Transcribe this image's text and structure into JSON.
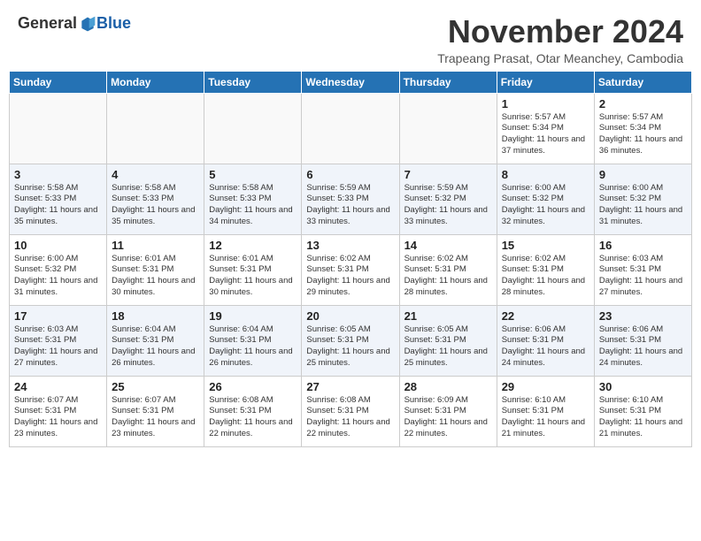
{
  "header": {
    "logo_general": "General",
    "logo_blue": "Blue",
    "month_title": "November 2024",
    "subtitle": "Trapeang Prasat, Otar Meanchey, Cambodia"
  },
  "weekdays": [
    "Sunday",
    "Monday",
    "Tuesday",
    "Wednesday",
    "Thursday",
    "Friday",
    "Saturday"
  ],
  "weeks": [
    [
      {
        "day": "",
        "info": ""
      },
      {
        "day": "",
        "info": ""
      },
      {
        "day": "",
        "info": ""
      },
      {
        "day": "",
        "info": ""
      },
      {
        "day": "",
        "info": ""
      },
      {
        "day": "1",
        "info": "Sunrise: 5:57 AM\nSunset: 5:34 PM\nDaylight: 11 hours\nand 37 minutes."
      },
      {
        "day": "2",
        "info": "Sunrise: 5:57 AM\nSunset: 5:34 PM\nDaylight: 11 hours\nand 36 minutes."
      }
    ],
    [
      {
        "day": "3",
        "info": "Sunrise: 5:58 AM\nSunset: 5:33 PM\nDaylight: 11 hours\nand 35 minutes."
      },
      {
        "day": "4",
        "info": "Sunrise: 5:58 AM\nSunset: 5:33 PM\nDaylight: 11 hours\nand 35 minutes."
      },
      {
        "day": "5",
        "info": "Sunrise: 5:58 AM\nSunset: 5:33 PM\nDaylight: 11 hours\nand 34 minutes."
      },
      {
        "day": "6",
        "info": "Sunrise: 5:59 AM\nSunset: 5:33 PM\nDaylight: 11 hours\nand 33 minutes."
      },
      {
        "day": "7",
        "info": "Sunrise: 5:59 AM\nSunset: 5:32 PM\nDaylight: 11 hours\nand 33 minutes."
      },
      {
        "day": "8",
        "info": "Sunrise: 6:00 AM\nSunset: 5:32 PM\nDaylight: 11 hours\nand 32 minutes."
      },
      {
        "day": "9",
        "info": "Sunrise: 6:00 AM\nSunset: 5:32 PM\nDaylight: 11 hours\nand 31 minutes."
      }
    ],
    [
      {
        "day": "10",
        "info": "Sunrise: 6:00 AM\nSunset: 5:32 PM\nDaylight: 11 hours\nand 31 minutes."
      },
      {
        "day": "11",
        "info": "Sunrise: 6:01 AM\nSunset: 5:31 PM\nDaylight: 11 hours\nand 30 minutes."
      },
      {
        "day": "12",
        "info": "Sunrise: 6:01 AM\nSunset: 5:31 PM\nDaylight: 11 hours\nand 30 minutes."
      },
      {
        "day": "13",
        "info": "Sunrise: 6:02 AM\nSunset: 5:31 PM\nDaylight: 11 hours\nand 29 minutes."
      },
      {
        "day": "14",
        "info": "Sunrise: 6:02 AM\nSunset: 5:31 PM\nDaylight: 11 hours\nand 28 minutes."
      },
      {
        "day": "15",
        "info": "Sunrise: 6:02 AM\nSunset: 5:31 PM\nDaylight: 11 hours\nand 28 minutes."
      },
      {
        "day": "16",
        "info": "Sunrise: 6:03 AM\nSunset: 5:31 PM\nDaylight: 11 hours\nand 27 minutes."
      }
    ],
    [
      {
        "day": "17",
        "info": "Sunrise: 6:03 AM\nSunset: 5:31 PM\nDaylight: 11 hours\nand 27 minutes."
      },
      {
        "day": "18",
        "info": "Sunrise: 6:04 AM\nSunset: 5:31 PM\nDaylight: 11 hours\nand 26 minutes."
      },
      {
        "day": "19",
        "info": "Sunrise: 6:04 AM\nSunset: 5:31 PM\nDaylight: 11 hours\nand 26 minutes."
      },
      {
        "day": "20",
        "info": "Sunrise: 6:05 AM\nSunset: 5:31 PM\nDaylight: 11 hours\nand 25 minutes."
      },
      {
        "day": "21",
        "info": "Sunrise: 6:05 AM\nSunset: 5:31 PM\nDaylight: 11 hours\nand 25 minutes."
      },
      {
        "day": "22",
        "info": "Sunrise: 6:06 AM\nSunset: 5:31 PM\nDaylight: 11 hours\nand 24 minutes."
      },
      {
        "day": "23",
        "info": "Sunrise: 6:06 AM\nSunset: 5:31 PM\nDaylight: 11 hours\nand 24 minutes."
      }
    ],
    [
      {
        "day": "24",
        "info": "Sunrise: 6:07 AM\nSunset: 5:31 PM\nDaylight: 11 hours\nand 23 minutes."
      },
      {
        "day": "25",
        "info": "Sunrise: 6:07 AM\nSunset: 5:31 PM\nDaylight: 11 hours\nand 23 minutes."
      },
      {
        "day": "26",
        "info": "Sunrise: 6:08 AM\nSunset: 5:31 PM\nDaylight: 11 hours\nand 22 minutes."
      },
      {
        "day": "27",
        "info": "Sunrise: 6:08 AM\nSunset: 5:31 PM\nDaylight: 11 hours\nand 22 minutes."
      },
      {
        "day": "28",
        "info": "Sunrise: 6:09 AM\nSunset: 5:31 PM\nDaylight: 11 hours\nand 22 minutes."
      },
      {
        "day": "29",
        "info": "Sunrise: 6:10 AM\nSunset: 5:31 PM\nDaylight: 11 hours\nand 21 minutes."
      },
      {
        "day": "30",
        "info": "Sunrise: 6:10 AM\nSunset: 5:31 PM\nDaylight: 11 hours\nand 21 minutes."
      }
    ]
  ]
}
